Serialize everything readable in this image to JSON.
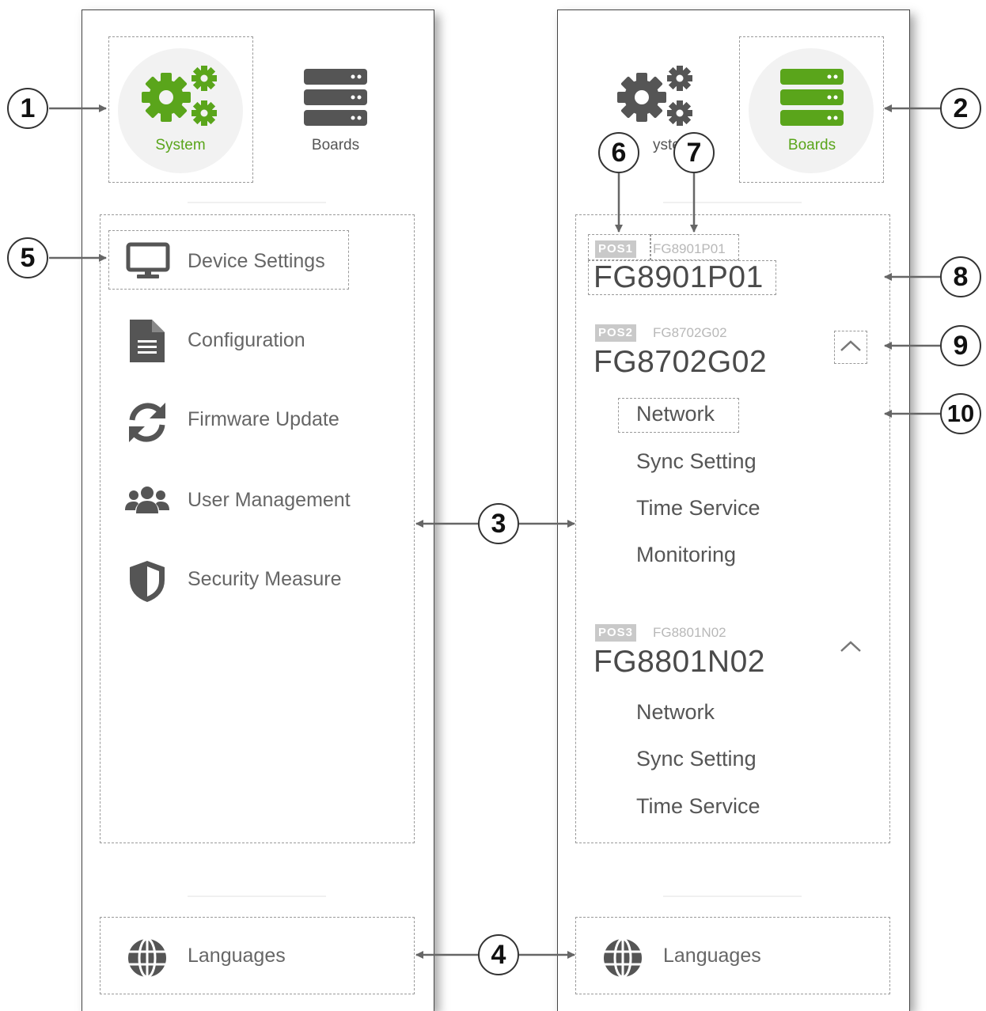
{
  "left_panel": {
    "tabs": [
      {
        "label": "System",
        "icon": "gears-icon",
        "active": true
      },
      {
        "label": "Boards",
        "icon": "boards-icon",
        "active": false
      }
    ],
    "menu": [
      {
        "label": "Device Settings",
        "icon": "monitor-icon"
      },
      {
        "label": "Configuration",
        "icon": "document-icon"
      },
      {
        "label": "Firmware Update",
        "icon": "sync-icon"
      },
      {
        "label": "User Management",
        "icon": "users-icon"
      },
      {
        "label": "Security Measure",
        "icon": "shield-icon"
      }
    ],
    "languages": {
      "label": "Languages",
      "icon": "globe-icon"
    }
  },
  "right_panel": {
    "tabs": [
      {
        "label": "System",
        "visible_text": "yste",
        "icon": "gears-icon",
        "active": false
      },
      {
        "label": "Boards",
        "icon": "boards-icon",
        "active": true
      }
    ],
    "boards": [
      {
        "pos": "POS1",
        "code": "FG8901P01",
        "title": "FG8901P01",
        "expanded": false,
        "items": []
      },
      {
        "pos": "POS2",
        "code": "FG8702G02",
        "title": "FG8702G02",
        "expanded": true,
        "items": [
          "Network",
          "Sync Setting",
          "Time Service",
          "Monitoring"
        ]
      },
      {
        "pos": "POS3",
        "code": "FG8801N02",
        "title": "FG8801N02",
        "expanded": true,
        "items": [
          "Network",
          "Sync Setting",
          "Time Service"
        ]
      }
    ],
    "languages": {
      "label": "Languages",
      "icon": "globe-icon"
    }
  },
  "callouts": [
    "1",
    "2",
    "3",
    "4",
    "5",
    "6",
    "7",
    "8",
    "9",
    "10"
  ],
  "colors": {
    "accent": "#5aa51b",
    "icon_gray": "#555555",
    "border": "#444444"
  }
}
